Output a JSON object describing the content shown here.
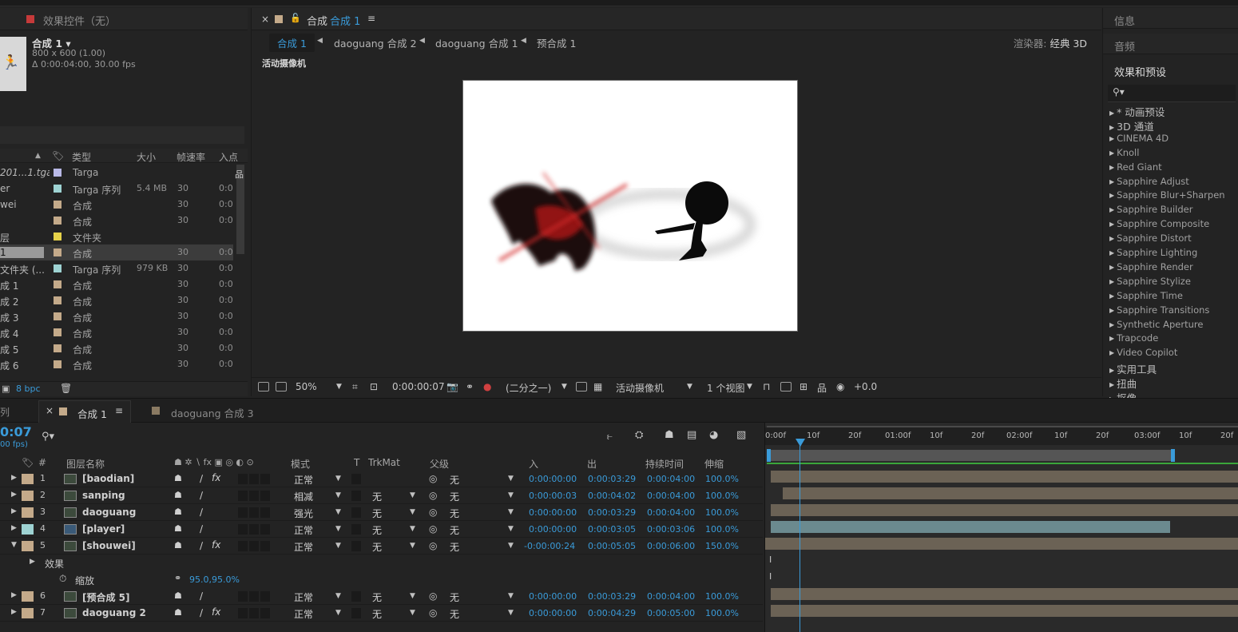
{
  "project_panel": {
    "tab_label": "效果控件（无）",
    "comp_name": "合成 1 ▾",
    "comp_dims": "800 x 600 (1.00)",
    "comp_duration": "Δ 0:00:04:00, 30.00 fps",
    "columns": [
      "类型",
      "大小",
      "帧速率",
      "入点"
    ],
    "rows": [
      {
        "name": "201...1.tga",
        "color": "#b8b8e6",
        "type": "Targa",
        "size": "",
        "fps": "",
        "in": ""
      },
      {
        "name": "er",
        "color": "#9ed3d3",
        "type": "Targa 序列",
        "size": "5.4 MB",
        "fps": "30",
        "in": "0:0"
      },
      {
        "name": "wei",
        "color": "#c4aa8a",
        "type": "合成",
        "size": "",
        "fps": "30",
        "in": "0:0"
      },
      {
        "name": "",
        "color": "#c4aa8a",
        "type": "合成",
        "size": "",
        "fps": "30",
        "in": "0:0"
      },
      {
        "name": "层",
        "color": "#e6d24a",
        "type": "文件夹",
        "size": "",
        "fps": "",
        "in": ""
      },
      {
        "name": "1",
        "color": "#c4aa8a",
        "type": "合成",
        "size": "",
        "fps": "30",
        "in": "0:0"
      },
      {
        "name": "文件夹 (...",
        "color": "#9ed3d3",
        "type": "Targa 序列",
        "size": "979 KB",
        "fps": "30",
        "in": "0:0"
      },
      {
        "name": "成 1",
        "color": "#c4aa8a",
        "type": "合成",
        "size": "",
        "fps": "30",
        "in": "0:0"
      },
      {
        "name": "成 2",
        "color": "#c4aa8a",
        "type": "合成",
        "size": "",
        "fps": "30",
        "in": "0:0"
      },
      {
        "name": "成 3",
        "color": "#c4aa8a",
        "type": "合成",
        "size": "",
        "fps": "30",
        "in": "0:0"
      },
      {
        "name": "成 4",
        "color": "#c4aa8a",
        "type": "合成",
        "size": "",
        "fps": "30",
        "in": "0:0"
      },
      {
        "name": "成 5",
        "color": "#c4aa8a",
        "type": "合成",
        "size": "",
        "fps": "30",
        "in": "0:0"
      },
      {
        "name": "成 6",
        "color": "#c4aa8a",
        "type": "合成",
        "size": "",
        "fps": "30",
        "in": "0:0"
      }
    ],
    "bpc": "8 bpc"
  },
  "viewer": {
    "tab_label": "合成",
    "tab_highlight": "合成 1",
    "breadcrumbs": [
      "合成 1",
      "daoguang 合成 2",
      "daoguang 合成 1",
      "预合成 1"
    ],
    "renderer_label": "渲染器:",
    "renderer_value": "经典 3D",
    "camera_label": "活动摄像机",
    "toolbar": {
      "zoom": "50%",
      "timecode": "0:00:00:07",
      "resolution": "(二分之一)",
      "camera": "活动摄像机",
      "views": "1 个视图",
      "exposure": "+0.0"
    }
  },
  "right_panels": {
    "info": "信息",
    "audio": "音频",
    "effects_title": "效果和预设",
    "effects": [
      "* 动画预设",
      "3D 通道",
      "CINEMA 4D",
      "Knoll",
      "Red Giant",
      "Sapphire Adjust",
      "Sapphire Blur+Sharpen",
      "Sapphire Builder",
      "Sapphire Composite",
      "Sapphire Distort",
      "Sapphire Lighting",
      "Sapphire Render",
      "Sapphire Stylize",
      "Sapphire Time",
      "Sapphire Transitions",
      "Synthetic Aperture",
      "Trapcode",
      "Video Copilot",
      "实用工具",
      "扭曲",
      "抠像"
    ]
  },
  "timeline": {
    "left_tab": "列",
    "active_tab": "合成 1",
    "other_tab": "daoguang 合成 3",
    "time": "0:07",
    "fps": "00 fps)",
    "columns": {
      "num": "#",
      "name": "图层名称",
      "mode": "模式",
      "t": "T",
      "trkmat": "TrkMat",
      "parent": "父级",
      "in": "入",
      "out": "出",
      "duration": "持续时间",
      "stretch": "伸缩"
    },
    "layers": [
      {
        "num": "1",
        "name": "[baodian]",
        "color": "#c4aa8a",
        "fx": true,
        "mode": "正常",
        "trkmat": "",
        "parent": "无",
        "in": "0:00:00:00",
        "out": "0:00:03:29",
        "dur": "0:00:04:00",
        "stretch": "100.0%"
      },
      {
        "num": "2",
        "name": "sanping",
        "color": "#c4aa8a",
        "fx": false,
        "mode": "相减",
        "trkmat": "无",
        "parent": "无",
        "in": "0:00:00:03",
        "out": "0:00:04:02",
        "dur": "0:00:04:00",
        "stretch": "100.0%"
      },
      {
        "num": "3",
        "name": "daoguang",
        "color": "#c4aa8a",
        "fx": false,
        "mode": "强光",
        "trkmat": "无",
        "parent": "无",
        "in": "0:00:00:00",
        "out": "0:00:03:29",
        "dur": "0:00:04:00",
        "stretch": "100.0%"
      },
      {
        "num": "4",
        "name": "[player]",
        "color": "#9ed3d3",
        "fx": false,
        "mode": "正常",
        "trkmat": "无",
        "parent": "无",
        "in": "0:00:00:00",
        "out": "0:00:03:05",
        "dur": "0:00:03:06",
        "stretch": "100.0%"
      },
      {
        "num": "5",
        "name": "[shouwei]",
        "color": "#c4aa8a",
        "fx": true,
        "mode": "正常",
        "trkmat": "无",
        "parent": "无",
        "in": "-0:00:00:24",
        "out": "0:00:05:05",
        "dur": "0:00:06:00",
        "stretch": "150.0%"
      },
      {
        "num": "6",
        "name": "[预合成 5]",
        "color": "#c4aa8a",
        "fx": false,
        "mode": "正常",
        "trkmat": "无",
        "parent": "无",
        "in": "0:00:00:00",
        "out": "0:00:03:29",
        "dur": "0:00:04:00",
        "stretch": "100.0%"
      },
      {
        "num": "7",
        "name": "daoguang 2",
        "color": "#c4aa8a",
        "fx": true,
        "mode": "正常",
        "trkmat": "无",
        "parent": "无",
        "in": "0:00:00:00",
        "out": "0:00:04:29",
        "dur": "0:00:05:00",
        "stretch": "100.0%"
      }
    ],
    "sub_effects": "效果",
    "sub_scale_label": "缩放",
    "sub_scale_value": "95.0,95.0%",
    "ruler": [
      "0:00f",
      "10f",
      "20f",
      "01:00f",
      "10f",
      "20f",
      "02:00f",
      "10f",
      "20f",
      "03:00f",
      "10f",
      "20f"
    ]
  }
}
